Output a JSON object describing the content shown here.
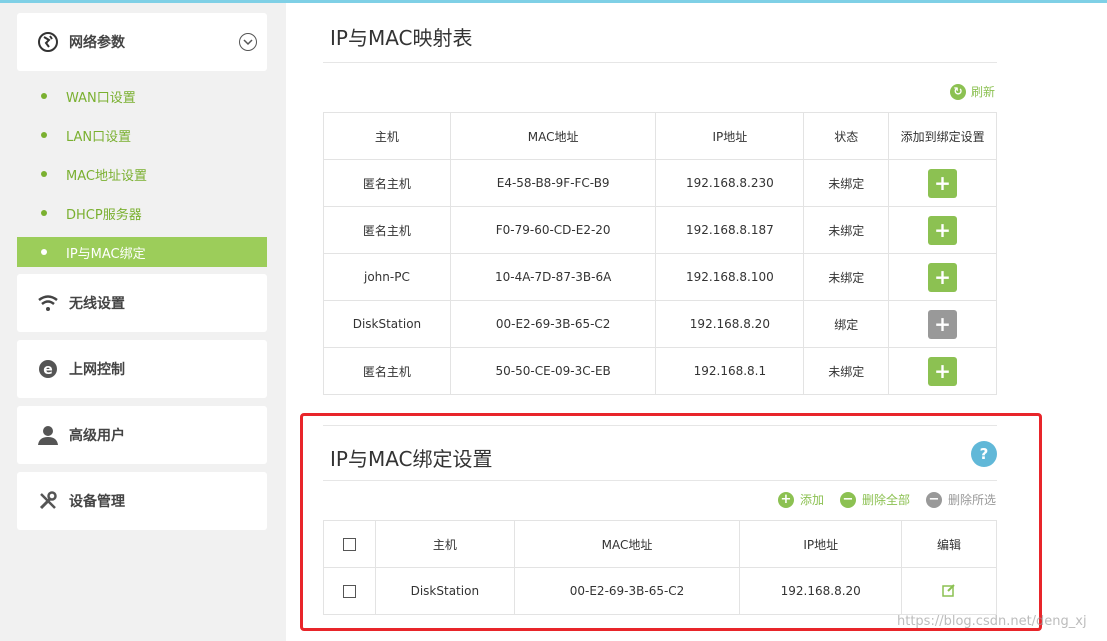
{
  "sidebar": {
    "network": {
      "label": "网络参数",
      "icon": "globe-icon"
    },
    "sub_items": [
      {
        "label": "WAN口设置"
      },
      {
        "label": "LAN口设置"
      },
      {
        "label": "MAC地址设置"
      },
      {
        "label": "DHCP服务器"
      },
      {
        "label": "IP与MAC绑定",
        "active": true
      }
    ],
    "wireless": {
      "label": "无线设置",
      "icon": "wifi-icon"
    },
    "access": {
      "label": "上网控制",
      "icon": "e-icon"
    },
    "advanced_user": {
      "label": "高级用户",
      "icon": "user-icon"
    },
    "device_mgmt": {
      "label": "设备管理",
      "icon": "tools-icon"
    }
  },
  "mapping": {
    "title": "IP与MAC映射表",
    "refresh_label": "刷新",
    "headers": [
      "主机",
      "MAC地址",
      "IP地址",
      "状态",
      "添加到绑定设置"
    ],
    "rows": [
      {
        "host": "匿名主机",
        "mac": "E4-58-B8-9F-FC-B9",
        "ip": "192.168.8.230",
        "status": "未绑定",
        "bound": false
      },
      {
        "host": "匿名主机",
        "mac": "F0-79-60-CD-E2-20",
        "ip": "192.168.8.187",
        "status": "未绑定",
        "bound": false
      },
      {
        "host": "john-PC",
        "mac": "10-4A-7D-87-3B-6A",
        "ip": "192.168.8.100",
        "status": "未绑定",
        "bound": false
      },
      {
        "host": "DiskStation",
        "mac": "00-E2-69-3B-65-C2",
        "ip": "192.168.8.20",
        "status": "绑定",
        "bound": true
      },
      {
        "host": "匿名主机",
        "mac": "50-50-CE-09-3C-EB",
        "ip": "192.168.8.1",
        "status": "未绑定",
        "bound": false
      }
    ]
  },
  "binding": {
    "title": "IP与MAC绑定设置",
    "help": "?",
    "add_label": "添加",
    "delete_all_label": "删除全部",
    "delete_selected_label": "删除所选",
    "headers": [
      "主机",
      "MAC地址",
      "IP地址",
      "编辑"
    ],
    "rows": [
      {
        "host": "DiskStation",
        "mac": "00-E2-69-3B-65-C2",
        "ip": "192.168.8.20"
      }
    ]
  },
  "watermark": "https://blog.csdn.net/deng_xj",
  "colors": {
    "accent_green": "#8cc152",
    "highlight_red": "#e8252a",
    "help_blue": "#61b8d8"
  }
}
